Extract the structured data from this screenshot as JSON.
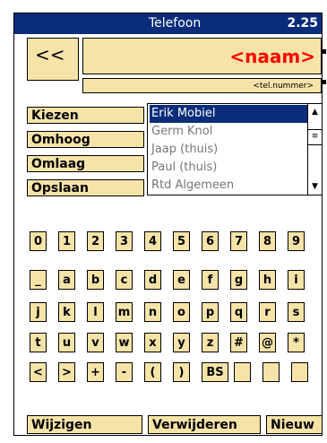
{
  "titlebar": {
    "title": "Telefoon",
    "time": "2.25"
  },
  "header": {
    "back_label": "<<",
    "name": "<naam>",
    "tel": "<tel.nummer>"
  },
  "side_buttons": [
    "Kiezen",
    "Omhoog",
    "Omlaag",
    "Opslaan"
  ],
  "contacts": {
    "items": [
      "Erik Mobiel",
      "Germ Knol",
      "Jaap (thuis)",
      "Paul (thuis)",
      "Rtd Algemeen"
    ],
    "selected_index": 0
  },
  "keyboard": {
    "rows": [
      [
        "0",
        "1",
        "2",
        "3",
        "4",
        "5",
        "6",
        "7",
        "8",
        "9"
      ],
      [
        "_",
        "a",
        "b",
        "c",
        "d",
        "e",
        "f",
        "g",
        "h",
        "i"
      ],
      [
        "j",
        "k",
        "l",
        "m",
        "n",
        "o",
        "p",
        "q",
        "r",
        "s"
      ],
      [
        "t",
        "u",
        "v",
        "w",
        "x",
        "y",
        "z",
        "#",
        "@",
        "*"
      ],
      [
        "<",
        ">",
        "+",
        "-",
        "(",
        ")",
        "BS",
        "",
        "",
        ""
      ]
    ]
  },
  "bottom_buttons": {
    "edit": "Wijzigen",
    "delete": "Verwijderen",
    "new": "Nieuw"
  },
  "colors": {
    "titlebar": "#0a2c7a",
    "button": "#f5e3a8",
    "name_text": "#ff0000"
  }
}
